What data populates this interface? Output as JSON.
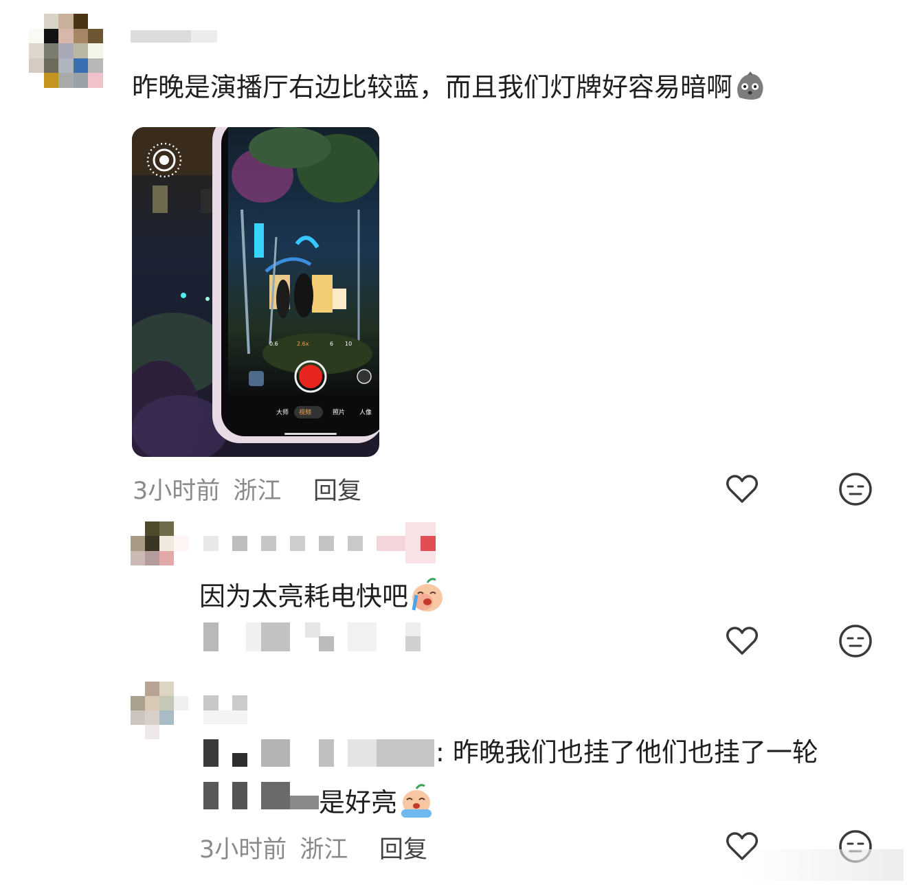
{
  "comments": [
    {
      "text": "昨晚是演播厅右边比较蓝，而且我们灯牌好容易暗啊",
      "time": "3小时前",
      "location": "浙江",
      "reply_label": "回复",
      "emoji_icon": "gray-face-emoji-icon"
    },
    {
      "text": "因为太亮耗电快吧",
      "emoji_icon": "crying-peach-emoji-icon"
    },
    {
      "text_line1": ": 昨晚我们也挂了他们也挂了一轮",
      "text_line2": "是好亮",
      "time": "3小时前",
      "location": "浙江",
      "reply_label": "回复",
      "emoji_icon": "crying-peach-emoji-icon"
    }
  ],
  "photo": {
    "camera_modes": [
      "大师",
      "视频",
      "照片",
      "人像"
    ],
    "zoom_levels": [
      "0.6",
      "2.6x",
      "6",
      "10"
    ]
  },
  "colors": {
    "text": "#1f1f1f",
    "meta": "#8a8a8a",
    "icon": "#3a3a3a",
    "record": "#e8261f"
  }
}
